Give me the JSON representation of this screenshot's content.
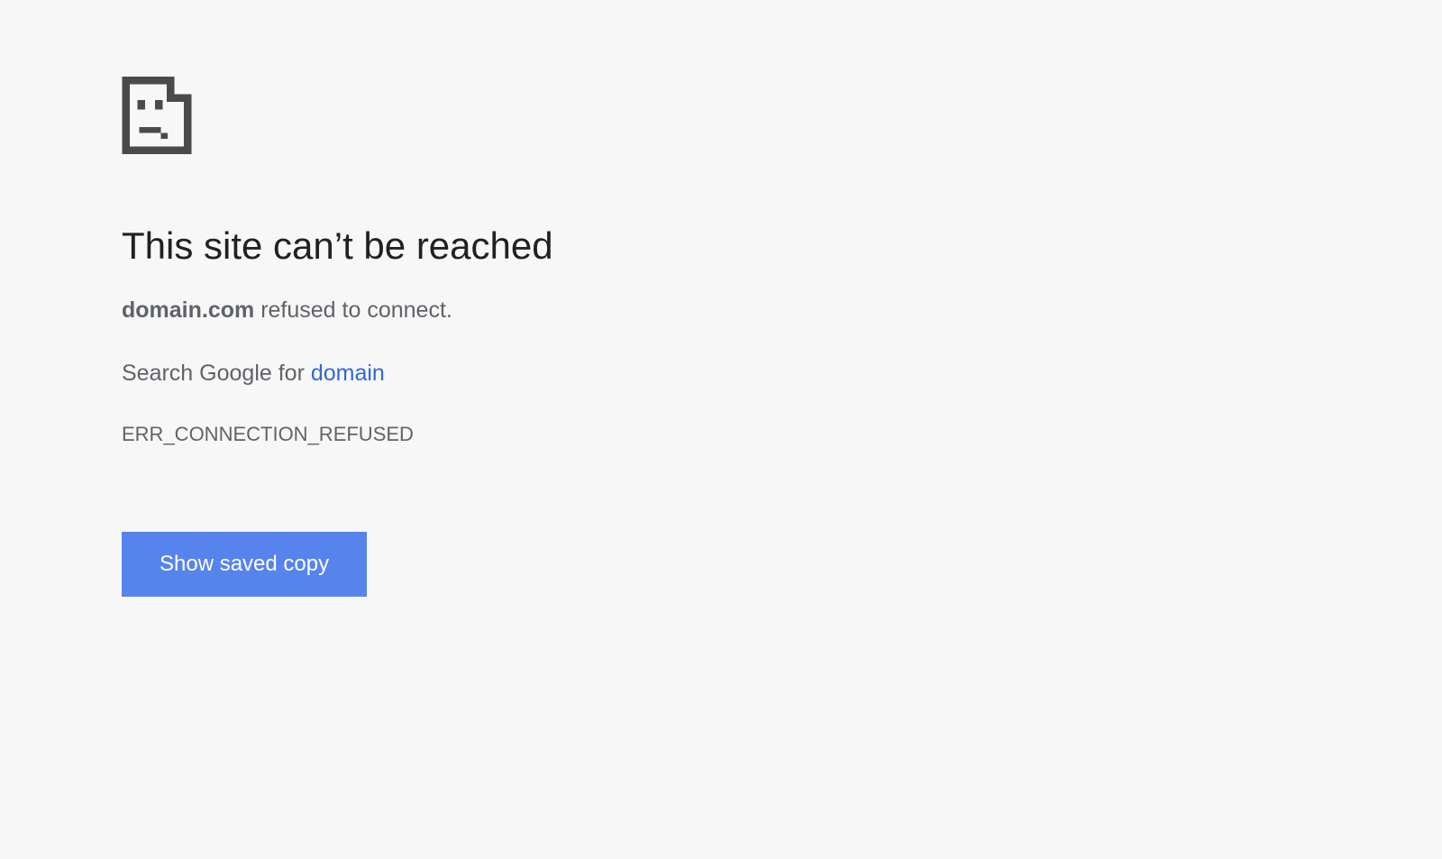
{
  "error": {
    "heading": "This site can’t be reached",
    "domain": "domain.com",
    "refused_text": " refused to connect.",
    "search_prefix": "Search Google for ",
    "search_link_text": "domain",
    "code": "ERR_CONNECTION_REFUSED",
    "button_label": "Show saved copy"
  }
}
